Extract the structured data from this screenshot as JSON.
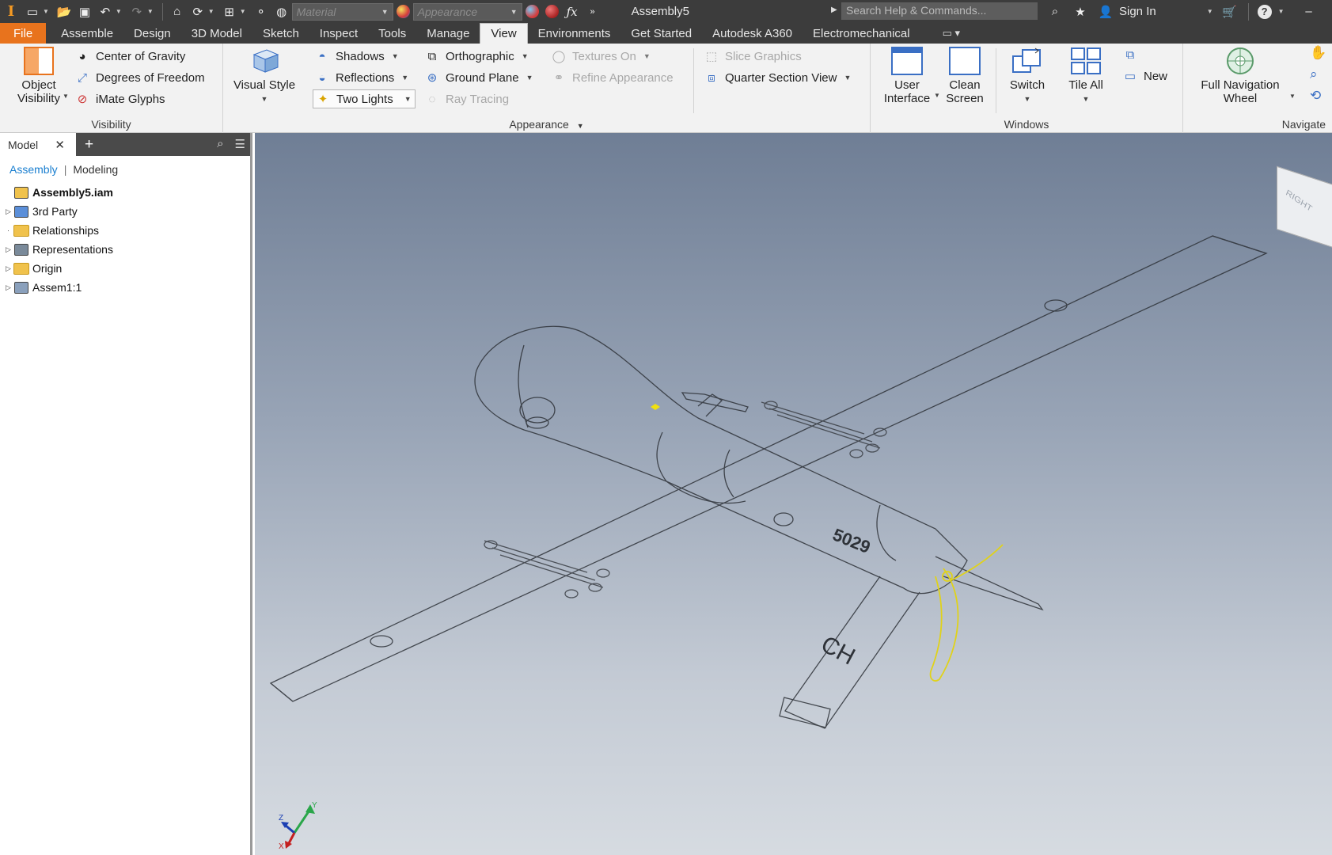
{
  "qat": {
    "material_placeholder": "Material",
    "appearance_placeholder": "Appearance",
    "doc_title": "Assembly5",
    "search_placeholder": "Search Help & Commands...",
    "sign_in": "Sign In"
  },
  "tabs": [
    "File",
    "Assemble",
    "Design",
    "3D Model",
    "Sketch",
    "Inspect",
    "Tools",
    "Manage",
    "View",
    "Environments",
    "Get Started",
    "Autodesk A360",
    "Electromechanical"
  ],
  "active_tab": "View",
  "ribbon": {
    "visibility": {
      "title": "Visibility",
      "object_visibility": "Object\nVisibility",
      "center_of_gravity": "Center of Gravity",
      "degrees_of_freedom": "Degrees of Freedom",
      "imate_glyphs": "iMate Glyphs"
    },
    "appearance": {
      "title": "Appearance",
      "visual_style": "Visual Style",
      "shadows": "Shadows",
      "reflections": "Reflections",
      "two_lights": "Two Lights",
      "orthographic": "Orthographic",
      "ground_plane": "Ground Plane",
      "ray_tracing": "Ray Tracing",
      "textures_on": "Textures On",
      "refine_appearance": "Refine Appearance",
      "slice_graphics": "Slice Graphics",
      "quarter_section_view": "Quarter Section View"
    },
    "windows": {
      "title": "Windows",
      "user_interface": "User\nInterface",
      "clean_screen": "Clean\nScreen",
      "switch": "Switch",
      "tile_all": "Tile All",
      "new": "New"
    },
    "navigate": {
      "title": "Navigate",
      "full_navigation_wheel": "Full Navigation\nWheel"
    }
  },
  "browser": {
    "tab_label": "Model",
    "subtab_assembly": "Assembly",
    "subtab_modeling": "Modeling",
    "tree": [
      {
        "label": "Assembly5.iam",
        "icon": "assembly-icon",
        "root": true,
        "expandable": false
      },
      {
        "label": "3rd Party",
        "icon": "third-party-icon",
        "expandable": true
      },
      {
        "label": "Relationships",
        "icon": "folder-icon",
        "expandable": false
      },
      {
        "label": "Representations",
        "icon": "representations-icon",
        "expandable": true
      },
      {
        "label": "Origin",
        "icon": "folder-icon",
        "expandable": true
      },
      {
        "label": "Assem1:1",
        "icon": "subassembly-icon",
        "expandable": true
      }
    ]
  },
  "viewport": {
    "viewcube_face": "RIGHT",
    "fuselage_marking": "5029",
    "tail_marking": "CH",
    "colors": {
      "accent_orange": "#e8731d",
      "selection_yellow": "#e0d21a",
      "link_blue": "#1a7fd0"
    }
  }
}
